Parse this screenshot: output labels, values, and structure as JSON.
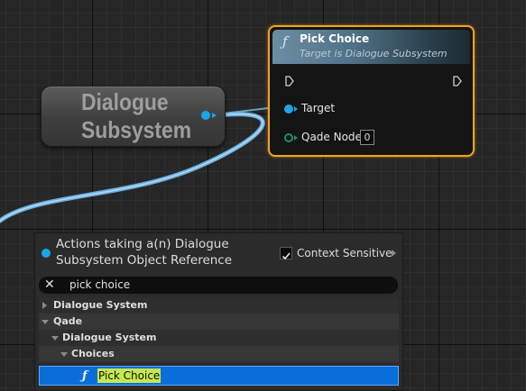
{
  "variable_node": {
    "title_line1": "Dialogue",
    "title_line2": "Subsystem"
  },
  "function_node": {
    "icon": "function-icon",
    "title": "Pick Choice",
    "subtitle": "Target is Dialogue Subsystem",
    "pins": [
      {
        "label": "Target"
      },
      {
        "label": "Qade Node",
        "value": "0"
      }
    ]
  },
  "action_menu": {
    "title": "Actions taking a(n) Dialogue Subsystem Object Reference",
    "context_sensitive": {
      "label": "Context Sensitive",
      "checked": true
    },
    "search": {
      "value": "pick choice"
    },
    "tree": [
      {
        "label": "Dialogue System",
        "expanded": false
      },
      {
        "label": "Qade",
        "expanded": true
      },
      {
        "label": "Dialogue System",
        "expanded": true
      },
      {
        "label": "Choices",
        "expanded": true
      },
      {
        "label": "Pick Choice",
        "selected": true,
        "icon": "function-icon"
      }
    ]
  },
  "colors": {
    "object_pin": "#1ea4e8",
    "integer_pin": "#1f8f5f",
    "selection": "#0a6ed8",
    "node_highlight": "#f2a31a",
    "search_highlight": "#c6e84f"
  }
}
